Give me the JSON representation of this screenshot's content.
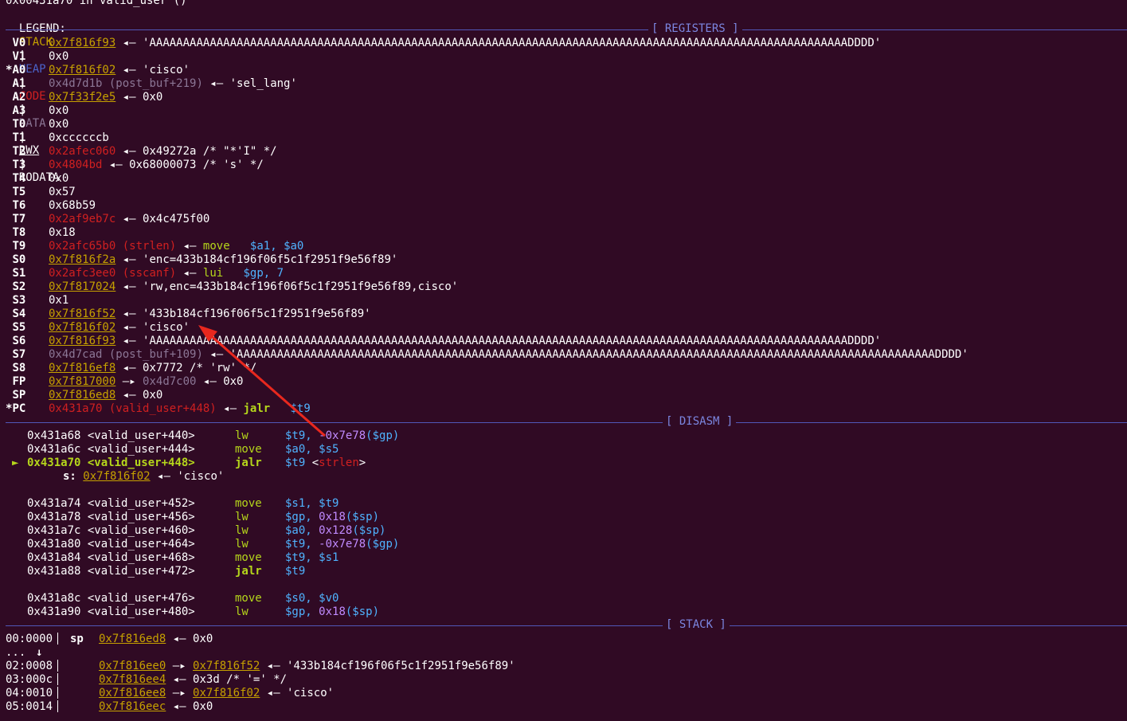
{
  "header": {
    "location": "0x00431a70 in valid_user ()",
    "legend_label": "LEGEND:",
    "legend": [
      "STACK",
      "HEAP",
      "CODE",
      "DATA",
      "RWX",
      "RODATA"
    ],
    "sep": "|"
  },
  "sections": {
    "registers": "[ REGISTERS ]",
    "disasm": "[ DISASM ]",
    "stack": "[ STACK ]"
  },
  "registers": [
    {
      "name": "V0",
      "mark": " ",
      "addr": "0x7f816f93",
      "cls": "stk",
      "sym": "",
      "arr": "◂—",
      "val": "'AAAAAAAAAAAAAAAAAAAAAAAAAAAAAAAAAAAAAAAAAAAAAAAAAAAAAAAAAAAAAAAAAAAAAAAAAAAAAAAAAAAAAAAAAAAAAAAAAAAAAAAADDDD'",
      "valcls": "white"
    },
    {
      "name": "V1",
      "mark": " ",
      "addr": "0x0",
      "cls": "white",
      "sym": "",
      "arr": "",
      "val": "",
      "valcls": "white"
    },
    {
      "name": "A0",
      "mark": "*",
      "addr": "0x7f816f02",
      "cls": "stk",
      "sym": "",
      "arr": "◂—",
      "val": "'cisco'",
      "valcls": "white"
    },
    {
      "name": "A1",
      "mark": " ",
      "addr": "0x4d7d1b",
      "cls": "data",
      "sym": "(post_buf+219)",
      "arr": "◂—",
      "val": "'sel_lang'",
      "valcls": "white"
    },
    {
      "name": "A2",
      "mark": " ",
      "addr": "0x7f33f2e5",
      "cls": "stk",
      "sym": "",
      "arr": "◂—",
      "val": "0x0",
      "valcls": "white"
    },
    {
      "name": "A3",
      "mark": " ",
      "addr": "0x0",
      "cls": "white",
      "sym": "",
      "arr": "",
      "val": "",
      "valcls": "white"
    },
    {
      "name": "T0",
      "mark": " ",
      "addr": "0x0",
      "cls": "white",
      "sym": "",
      "arr": "",
      "val": "",
      "valcls": "white"
    },
    {
      "name": "T1",
      "mark": " ",
      "addr": "0xccccccb",
      "cls": "white",
      "sym": "",
      "arr": "",
      "val": "",
      "valcls": "white"
    },
    {
      "name": "T2",
      "mark": " ",
      "addr": "0x2afec060",
      "cls": "code",
      "sym": "",
      "arr": "◂—",
      "val": "0x49272a /* \"*'I\" */",
      "valcls": "white"
    },
    {
      "name": "T3",
      "mark": " ",
      "addr": "0x4804bd",
      "cls": "code",
      "sym": "",
      "arr": "◂—",
      "val": "0x68000073 /* 's' */",
      "valcls": "white"
    },
    {
      "name": "T4",
      "mark": " ",
      "addr": "0x0",
      "cls": "white",
      "sym": "",
      "arr": "",
      "val": "",
      "valcls": "white"
    },
    {
      "name": "T5",
      "mark": " ",
      "addr": "0x57",
      "cls": "white",
      "sym": "",
      "arr": "",
      "val": "",
      "valcls": "white"
    },
    {
      "name": "T6",
      "mark": " ",
      "addr": "0x68b59",
      "cls": "white",
      "sym": "",
      "arr": "",
      "val": "",
      "valcls": "white"
    },
    {
      "name": "T7",
      "mark": " ",
      "addr": "0x2af9eb7c",
      "cls": "code",
      "sym": "",
      "arr": "◂—",
      "val": "0x4c475f00",
      "valcls": "white"
    },
    {
      "name": "T8",
      "mark": " ",
      "addr": "0x18",
      "cls": "white",
      "sym": "",
      "arr": "",
      "val": "",
      "valcls": "white"
    },
    {
      "name": "T9",
      "mark": " ",
      "addr": "0x2afc65b0",
      "cls": "code",
      "sym": "(strlen)",
      "arr": "◂—",
      "val": "move",
      "valcls": "op",
      "args": "$a1, $a0"
    },
    {
      "name": "S0",
      "mark": " ",
      "addr": "0x7f816f2a",
      "cls": "stk",
      "sym": "",
      "arr": "◂—",
      "val": "'enc=433b184cf196f06f5c1f2951f9e56f89'",
      "valcls": "white"
    },
    {
      "name": "S1",
      "mark": " ",
      "addr": "0x2afc3ee0",
      "cls": "code",
      "sym": "(sscanf)",
      "arr": "◂—",
      "val": "lui",
      "valcls": "op",
      "args": "$gp, 7"
    },
    {
      "name": "S2",
      "mark": " ",
      "addr": "0x7f817024",
      "cls": "stk",
      "sym": "",
      "arr": "◂—",
      "val": "'rw,enc=433b184cf196f06f5c1f2951f9e56f89,cisco'",
      "valcls": "white"
    },
    {
      "name": "S3",
      "mark": " ",
      "addr": "0x1",
      "cls": "white",
      "sym": "",
      "arr": "",
      "val": "",
      "valcls": "white"
    },
    {
      "name": "S4",
      "mark": " ",
      "addr": "0x7f816f52",
      "cls": "stk",
      "sym": "",
      "arr": "◂—",
      "val": "'433b184cf196f06f5c1f2951f9e56f89'",
      "valcls": "white"
    },
    {
      "name": "S5",
      "mark": " ",
      "addr": "0x7f816f02",
      "cls": "stk",
      "sym": "",
      "arr": "◂—",
      "val": "'cisco'",
      "valcls": "white"
    },
    {
      "name": "S6",
      "mark": " ",
      "addr": "0x7f816f93",
      "cls": "stk",
      "sym": "",
      "arr": "◂—",
      "val": "'AAAAAAAAAAAAAAAAAAAAAAAAAAAAAAAAAAAAAAAAAAAAAAAAAAAAAAAAAAAAAAAAAAAAAAAAAAAAAAAAAAAAAAAAAAAAAAAAAAAAAAAADDDD'",
      "valcls": "white"
    },
    {
      "name": "S7",
      "mark": " ",
      "addr": "0x4d7cad",
      "cls": "data",
      "sym": "(post_buf+109)",
      "arr": "◂—",
      "val": "'AAAAAAAAAAAAAAAAAAAAAAAAAAAAAAAAAAAAAAAAAAAAAAAAAAAAAAAAAAAAAAAAAAAAAAAAAAAAAAAAAAAAAAAAAAAAAAAAAAAAAAAADDDD'",
      "valcls": "white"
    },
    {
      "name": "S8",
      "mark": " ",
      "addr": "0x7f816ef8",
      "cls": "stk",
      "sym": "",
      "arr": "◂—",
      "val": "0x7772 /* 'rw' */",
      "valcls": "white"
    },
    {
      "name": "FP",
      "mark": " ",
      "addr": "0x7f817000",
      "cls": "stk",
      "sym": "",
      "arr": "—▸",
      "val": "0x4d7c00",
      "valcls": "data",
      "tail": "◂— 0x0"
    },
    {
      "name": "SP",
      "mark": " ",
      "addr": "0x7f816ed8",
      "cls": "stk",
      "sym": "",
      "arr": "◂—",
      "val": "0x0",
      "valcls": "white"
    },
    {
      "name": "PC",
      "mark": "*",
      "addr": "0x431a70",
      "cls": "code",
      "sym": "(valid_user+448)",
      "arr": "◂—",
      "val": "jalr",
      "valcls": "opb",
      "args": "$t9"
    }
  ],
  "disasm": [
    {
      "addr": "0x431a68",
      "func": "<valid_user+440>",
      "op": "lw",
      "a1": "$t9,",
      "a2": "-0x7e78",
      "a3": "($gp)",
      "current": false
    },
    {
      "addr": "0x431a6c",
      "func": "<valid_user+444>",
      "op": "move",
      "a1": "$a0,",
      "a2": "",
      "a3": "$s5",
      "current": false
    },
    {
      "addr": "0x431a70",
      "func": "<valid_user+448>",
      "op": "jalr",
      "a1": "$t9",
      "a2": "",
      "a3": "",
      "target": "strlen",
      "current": true
    },
    {
      "addr": "0x431a74",
      "func": "<valid_user+452>",
      "op": "move",
      "a1": "$s1,",
      "a2": "",
      "a3": "$t9",
      "current": false
    },
    {
      "addr": "0x431a78",
      "func": "<valid_user+456>",
      "op": "lw",
      "a1": "$gp,",
      "a2": "0x18",
      "a3": "($sp)",
      "current": false
    },
    {
      "addr": "0x431a7c",
      "func": "<valid_user+460>",
      "op": "lw",
      "a1": "$a0,",
      "a2": "0x128",
      "a3": "($sp)",
      "current": false
    },
    {
      "addr": "0x431a80",
      "func": "<valid_user+464>",
      "op": "lw",
      "a1": "$t9,",
      "a2": "-0x7e78",
      "a3": "($gp)",
      "current": false
    },
    {
      "addr": "0x431a84",
      "func": "<valid_user+468>",
      "op": "move",
      "a1": "$t9,",
      "a2": "",
      "a3": "$s1",
      "current": false
    },
    {
      "addr": "0x431a88",
      "func": "<valid_user+472>",
      "op": "jalr",
      "a1": "$t9",
      "a2": "",
      "a3": "",
      "current": false
    },
    {
      "addr": "0x431a8c",
      "func": "<valid_user+476>",
      "op": "move",
      "a1": "$s0,",
      "a2": "",
      "a3": "$v0",
      "current": false
    },
    {
      "addr": "0x431a90",
      "func": "<valid_user+480>",
      "op": "lw",
      "a1": "$gp,",
      "a2": "0x18",
      "a3": "($sp)",
      "current": false
    }
  ],
  "call_arg": {
    "label": "s:",
    "addr": "0x7f816f02",
    "arr": "◂—",
    "val": "'cisco'"
  },
  "pc_marker": "►",
  "stack": [
    {
      "off": "00:0000",
      "reg": "sp",
      "addr": "0x7f816ed8",
      "arr": "◂—",
      "val": "0x0",
      "ptr": ""
    },
    {
      "off": "...",
      "reg": "↓",
      "addr": "",
      "arr": "",
      "val": "",
      "ptr": ""
    },
    {
      "off": "02:0008",
      "reg": "",
      "addr": "0x7f816ee0",
      "arr": "—▸",
      "val": "◂— '433b184cf196f06f5c1f2951f9e56f89'",
      "ptr": "0x7f816f52"
    },
    {
      "off": "03:000c",
      "reg": "",
      "addr": "0x7f816ee4",
      "arr": "◂—",
      "val": "0x3d /* '=' */",
      "ptr": ""
    },
    {
      "off": "04:0010",
      "reg": "",
      "addr": "0x7f816ee8",
      "arr": "—▸",
      "val": "◂— 'cisco'",
      "ptr": "0x7f816f02"
    },
    {
      "off": "05:0014",
      "reg": "",
      "addr": "0x7f816eec",
      "arr": "◂—",
      "val": "0x0",
      "ptr": ""
    }
  ],
  "colors": {
    "background": "#300a24",
    "stack": "#c6a100",
    "heap": "#4b63c9",
    "code": "#d02020",
    "data": "#8c7796",
    "opcode": "#b5d61b",
    "register": "#4fb3ff",
    "number": "#c08bff",
    "divider": "#5157b8",
    "annotation_arrow": "#e8281e"
  }
}
